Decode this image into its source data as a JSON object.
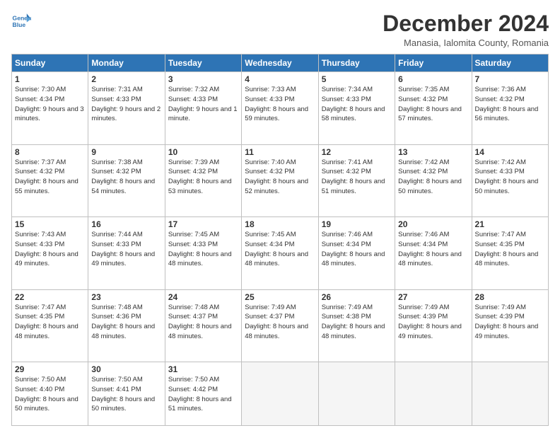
{
  "logo": {
    "line1": "General",
    "line2": "Blue"
  },
  "title": "December 2024",
  "subtitle": "Manasia, Ialomita County, Romania",
  "days_header": [
    "Sunday",
    "Monday",
    "Tuesday",
    "Wednesday",
    "Thursday",
    "Friday",
    "Saturday"
  ],
  "weeks": [
    [
      {
        "day": 1,
        "sunrise": "7:30 AM",
        "sunset": "4:34 PM",
        "daylight": "9 hours and 3 minutes."
      },
      {
        "day": 2,
        "sunrise": "7:31 AM",
        "sunset": "4:33 PM",
        "daylight": "9 hours and 2 minutes."
      },
      {
        "day": 3,
        "sunrise": "7:32 AM",
        "sunset": "4:33 PM",
        "daylight": "9 hours and 1 minute."
      },
      {
        "day": 4,
        "sunrise": "7:33 AM",
        "sunset": "4:33 PM",
        "daylight": "8 hours and 59 minutes."
      },
      {
        "day": 5,
        "sunrise": "7:34 AM",
        "sunset": "4:33 PM",
        "daylight": "8 hours and 58 minutes."
      },
      {
        "day": 6,
        "sunrise": "7:35 AM",
        "sunset": "4:32 PM",
        "daylight": "8 hours and 57 minutes."
      },
      {
        "day": 7,
        "sunrise": "7:36 AM",
        "sunset": "4:32 PM",
        "daylight": "8 hours and 56 minutes."
      }
    ],
    [
      {
        "day": 8,
        "sunrise": "7:37 AM",
        "sunset": "4:32 PM",
        "daylight": "8 hours and 55 minutes."
      },
      {
        "day": 9,
        "sunrise": "7:38 AM",
        "sunset": "4:32 PM",
        "daylight": "8 hours and 54 minutes."
      },
      {
        "day": 10,
        "sunrise": "7:39 AM",
        "sunset": "4:32 PM",
        "daylight": "8 hours and 53 minutes."
      },
      {
        "day": 11,
        "sunrise": "7:40 AM",
        "sunset": "4:32 PM",
        "daylight": "8 hours and 52 minutes."
      },
      {
        "day": 12,
        "sunrise": "7:41 AM",
        "sunset": "4:32 PM",
        "daylight": "8 hours and 51 minutes."
      },
      {
        "day": 13,
        "sunrise": "7:42 AM",
        "sunset": "4:32 PM",
        "daylight": "8 hours and 50 minutes."
      },
      {
        "day": 14,
        "sunrise": "7:42 AM",
        "sunset": "4:33 PM",
        "daylight": "8 hours and 50 minutes."
      }
    ],
    [
      {
        "day": 15,
        "sunrise": "7:43 AM",
        "sunset": "4:33 PM",
        "daylight": "8 hours and 49 minutes."
      },
      {
        "day": 16,
        "sunrise": "7:44 AM",
        "sunset": "4:33 PM",
        "daylight": "8 hours and 49 minutes."
      },
      {
        "day": 17,
        "sunrise": "7:45 AM",
        "sunset": "4:33 PM",
        "daylight": "8 hours and 48 minutes."
      },
      {
        "day": 18,
        "sunrise": "7:45 AM",
        "sunset": "4:34 PM",
        "daylight": "8 hours and 48 minutes."
      },
      {
        "day": 19,
        "sunrise": "7:46 AM",
        "sunset": "4:34 PM",
        "daylight": "8 hours and 48 minutes."
      },
      {
        "day": 20,
        "sunrise": "7:46 AM",
        "sunset": "4:34 PM",
        "daylight": "8 hours and 48 minutes."
      },
      {
        "day": 21,
        "sunrise": "7:47 AM",
        "sunset": "4:35 PM",
        "daylight": "8 hours and 48 minutes."
      }
    ],
    [
      {
        "day": 22,
        "sunrise": "7:47 AM",
        "sunset": "4:35 PM",
        "daylight": "8 hours and 48 minutes."
      },
      {
        "day": 23,
        "sunrise": "7:48 AM",
        "sunset": "4:36 PM",
        "daylight": "8 hours and 48 minutes."
      },
      {
        "day": 24,
        "sunrise": "7:48 AM",
        "sunset": "4:37 PM",
        "daylight": "8 hours and 48 minutes."
      },
      {
        "day": 25,
        "sunrise": "7:49 AM",
        "sunset": "4:37 PM",
        "daylight": "8 hours and 48 minutes."
      },
      {
        "day": 26,
        "sunrise": "7:49 AM",
        "sunset": "4:38 PM",
        "daylight": "8 hours and 48 minutes."
      },
      {
        "day": 27,
        "sunrise": "7:49 AM",
        "sunset": "4:39 PM",
        "daylight": "8 hours and 49 minutes."
      },
      {
        "day": 28,
        "sunrise": "7:49 AM",
        "sunset": "4:39 PM",
        "daylight": "8 hours and 49 minutes."
      }
    ],
    [
      {
        "day": 29,
        "sunrise": "7:50 AM",
        "sunset": "4:40 PM",
        "daylight": "8 hours and 50 minutes."
      },
      {
        "day": 30,
        "sunrise": "7:50 AM",
        "sunset": "4:41 PM",
        "daylight": "8 hours and 50 minutes."
      },
      {
        "day": 31,
        "sunrise": "7:50 AM",
        "sunset": "4:42 PM",
        "daylight": "8 hours and 51 minutes."
      },
      null,
      null,
      null,
      null
    ]
  ]
}
